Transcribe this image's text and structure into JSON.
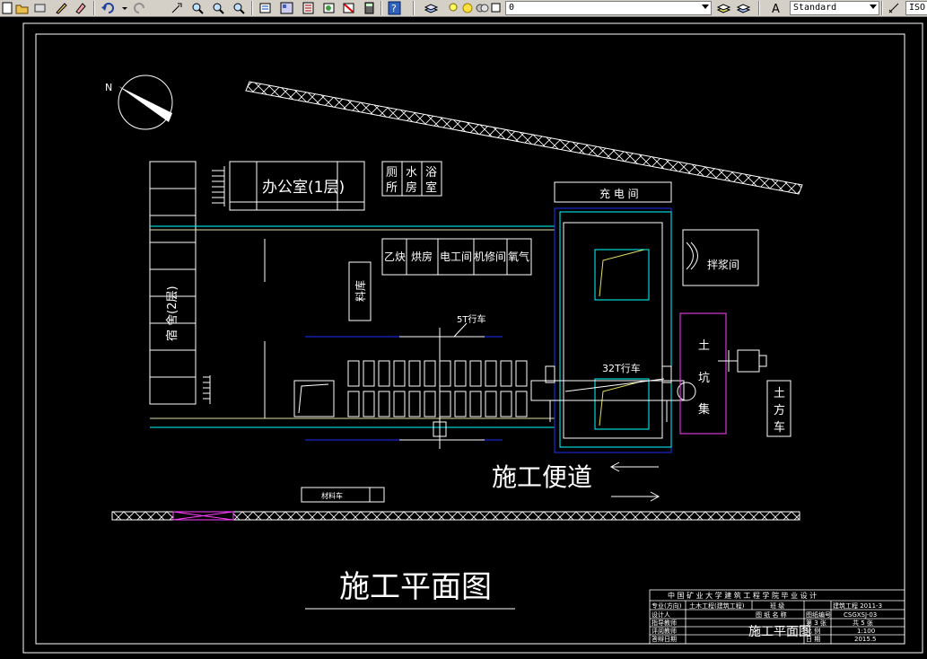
{
  "toolbar": {
    "layer_value": "0",
    "text_style": "Standard",
    "dim_style": "ISO"
  },
  "drawing": {
    "north": "N",
    "buildings": {
      "office": "办公室(1层)",
      "toilet_a": "厕",
      "toilet_b": "所",
      "water_a": "水",
      "water_b": "房",
      "bath_a": "浴",
      "bath_b": "室",
      "charge_room": "充 电 间",
      "warehouse": "宿 舍(2层)",
      "acetylene": "乙炔",
      "oven": "烘房",
      "electric": "电工间",
      "repair": "机修间",
      "oxygen": "氧气",
      "material": "料库",
      "mixing": "拌浆间",
      "pit_a": "土",
      "pit_b": "坑",
      "pit_c": "集",
      "soil_a": "土",
      "soil_b": "方",
      "soil_c": "车"
    },
    "crane_5t": "5T行车",
    "crane_32t": "32T行车",
    "road_label": "施工便道",
    "plan_title": "施工平面图",
    "truck_label": "材料车"
  },
  "title_block": {
    "header": "中 国 矿 业 大 学 建 筑 工 程 学 院 毕 业 设 计",
    "row1": [
      "专业(方向)",
      "土木工程(建筑工程)",
      "班 级",
      "建筑工程 2011-3"
    ],
    "row2": [
      "设计人",
      "图 纸 名 称",
      "图纸编号",
      "CSGXSJ-03"
    ],
    "row3": [
      "指导教师",
      "第 3 张",
      "共 5 张"
    ],
    "row4": [
      "评阅教师",
      "比 例",
      "1:100"
    ],
    "row5": [
      "答辩日期",
      "日 期",
      "2015.5"
    ],
    "drawing_name": "施工平面图"
  }
}
